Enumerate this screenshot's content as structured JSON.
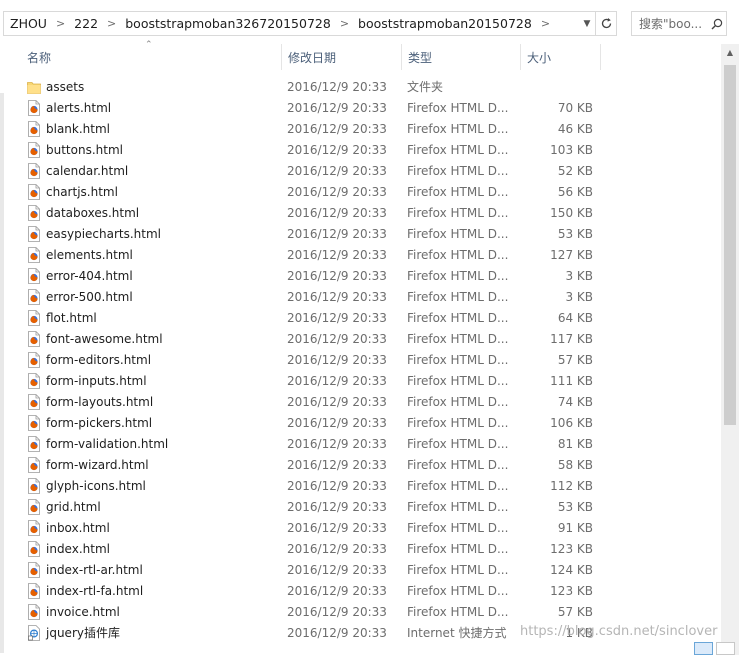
{
  "address_bar": {
    "breadcrumbs": [
      "ZHOU",
      "222",
      "booststrapmoban326720150728",
      "booststrapmoban20150728"
    ],
    "dropdown_icon": "chevron-down-icon",
    "refresh_icon": "refresh-icon"
  },
  "search": {
    "placeholder": "搜索\"boo...",
    "icon": "search-icon"
  },
  "columns": {
    "name": "名称",
    "date": "修改日期",
    "type": "类型",
    "size": "大小"
  },
  "files": [
    {
      "name": "assets",
      "date": "2016/12/9 20:33",
      "type": "文件夹",
      "size": "",
      "icon": "folder"
    },
    {
      "name": "alerts.html",
      "date": "2016/12/9 20:33",
      "type": "Firefox HTML D...",
      "size": "70 KB",
      "icon": "firefox"
    },
    {
      "name": "blank.html",
      "date": "2016/12/9 20:33",
      "type": "Firefox HTML D...",
      "size": "46 KB",
      "icon": "firefox"
    },
    {
      "name": "buttons.html",
      "date": "2016/12/9 20:33",
      "type": "Firefox HTML D...",
      "size": "103 KB",
      "icon": "firefox"
    },
    {
      "name": "calendar.html",
      "date": "2016/12/9 20:33",
      "type": "Firefox HTML D...",
      "size": "52 KB",
      "icon": "firefox"
    },
    {
      "name": "chartjs.html",
      "date": "2016/12/9 20:33",
      "type": "Firefox HTML D...",
      "size": "56 KB",
      "icon": "firefox"
    },
    {
      "name": "databoxes.html",
      "date": "2016/12/9 20:33",
      "type": "Firefox HTML D...",
      "size": "150 KB",
      "icon": "firefox"
    },
    {
      "name": "easypiecharts.html",
      "date": "2016/12/9 20:33",
      "type": "Firefox HTML D...",
      "size": "53 KB",
      "icon": "firefox"
    },
    {
      "name": "elements.html",
      "date": "2016/12/9 20:33",
      "type": "Firefox HTML D...",
      "size": "127 KB",
      "icon": "firefox"
    },
    {
      "name": "error-404.html",
      "date": "2016/12/9 20:33",
      "type": "Firefox HTML D...",
      "size": "3 KB",
      "icon": "firefox"
    },
    {
      "name": "error-500.html",
      "date": "2016/12/9 20:33",
      "type": "Firefox HTML D...",
      "size": "3 KB",
      "icon": "firefox"
    },
    {
      "name": "flot.html",
      "date": "2016/12/9 20:33",
      "type": "Firefox HTML D...",
      "size": "64 KB",
      "icon": "firefox"
    },
    {
      "name": "font-awesome.html",
      "date": "2016/12/9 20:33",
      "type": "Firefox HTML D...",
      "size": "117 KB",
      "icon": "firefox"
    },
    {
      "name": "form-editors.html",
      "date": "2016/12/9 20:33",
      "type": "Firefox HTML D...",
      "size": "57 KB",
      "icon": "firefox"
    },
    {
      "name": "form-inputs.html",
      "date": "2016/12/9 20:33",
      "type": "Firefox HTML D...",
      "size": "111 KB",
      "icon": "firefox"
    },
    {
      "name": "form-layouts.html",
      "date": "2016/12/9 20:33",
      "type": "Firefox HTML D...",
      "size": "74 KB",
      "icon": "firefox"
    },
    {
      "name": "form-pickers.html",
      "date": "2016/12/9 20:33",
      "type": "Firefox HTML D...",
      "size": "106 KB",
      "icon": "firefox"
    },
    {
      "name": "form-validation.html",
      "date": "2016/12/9 20:33",
      "type": "Firefox HTML D...",
      "size": "81 KB",
      "icon": "firefox"
    },
    {
      "name": "form-wizard.html",
      "date": "2016/12/9 20:33",
      "type": "Firefox HTML D...",
      "size": "58 KB",
      "icon": "firefox"
    },
    {
      "name": "glyph-icons.html",
      "date": "2016/12/9 20:33",
      "type": "Firefox HTML D...",
      "size": "112 KB",
      "icon": "firefox"
    },
    {
      "name": "grid.html",
      "date": "2016/12/9 20:33",
      "type": "Firefox HTML D...",
      "size": "53 KB",
      "icon": "firefox"
    },
    {
      "name": "inbox.html",
      "date": "2016/12/9 20:33",
      "type": "Firefox HTML D...",
      "size": "91 KB",
      "icon": "firefox"
    },
    {
      "name": "index.html",
      "date": "2016/12/9 20:33",
      "type": "Firefox HTML D...",
      "size": "123 KB",
      "icon": "firefox"
    },
    {
      "name": "index-rtl-ar.html",
      "date": "2016/12/9 20:33",
      "type": "Firefox HTML D...",
      "size": "124 KB",
      "icon": "firefox"
    },
    {
      "name": "index-rtl-fa.html",
      "date": "2016/12/9 20:33",
      "type": "Firefox HTML D...",
      "size": "123 KB",
      "icon": "firefox"
    },
    {
      "name": "invoice.html",
      "date": "2016/12/9 20:33",
      "type": "Firefox HTML D...",
      "size": "57 KB",
      "icon": "firefox"
    },
    {
      "name": "jquery插件库",
      "date": "2016/12/9 20:33",
      "type": "Internet 快捷方式",
      "size": "1 KB",
      "icon": "shortcut"
    }
  ],
  "watermark": "https://blog.csdn.net/sinclover",
  "colors": {
    "header_text": "#4c607a",
    "folder": "#f7d774",
    "firefox_orange": "#e66000",
    "selection_blue": "#dbeafa"
  }
}
